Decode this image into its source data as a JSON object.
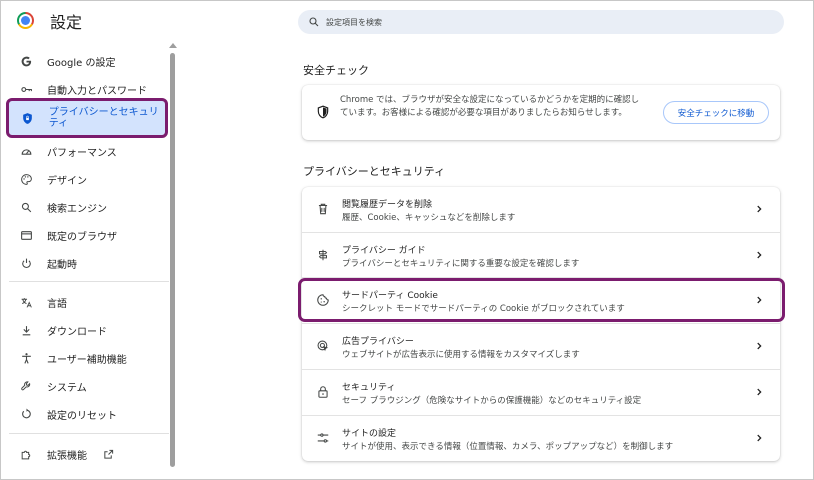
{
  "app": {
    "title": "設定"
  },
  "search": {
    "placeholder": "設定項目を検索"
  },
  "sidebar": {
    "items": [
      {
        "label": "Google の設定",
        "icon": "google-icon"
      },
      {
        "label": "自動入力とパスワード",
        "icon": "key-icon"
      },
      {
        "label": "プライバシーとセキュリティ",
        "icon": "shield-icon",
        "active": true
      },
      {
        "label": "パフォーマンス",
        "icon": "speedometer-icon"
      },
      {
        "label": "デザイン",
        "icon": "palette-icon"
      },
      {
        "label": "検索エンジン",
        "icon": "search-icon"
      },
      {
        "label": "既定のブラウザ",
        "icon": "browser-icon"
      },
      {
        "label": "起動時",
        "icon": "power-icon"
      },
      {
        "label": "言語",
        "icon": "translate-icon"
      },
      {
        "label": "ダウンロード",
        "icon": "download-icon"
      },
      {
        "label": "ユーザー補助機能",
        "icon": "accessibility-icon"
      },
      {
        "label": "システム",
        "icon": "wrench-icon"
      },
      {
        "label": "設定のリセット",
        "icon": "reset-icon"
      },
      {
        "label": "拡張機能",
        "icon": "puzzle-icon"
      }
    ]
  },
  "safety": {
    "section_title": "安全チェック",
    "description": "Chrome では、ブラウザが安全な設定になっているかどうかを定期的に確認しています。お客様による確認が必要な項目がありましたらお知らせします。",
    "button": "安全チェックに移動"
  },
  "privacy": {
    "section_title": "プライバシーとセキュリティ",
    "rows": [
      {
        "title": "閲覧履歴データを削除",
        "sub": "履歴、Cookie、キャッシュなどを削除します",
        "icon": "trash-icon"
      },
      {
        "title": "プライバシー ガイド",
        "sub": "プライバシーとセキュリティに関する重要な設定を確認します",
        "icon": "guide-icon"
      },
      {
        "title": "サードパーティ Cookie",
        "sub": "シークレット モードでサードパーティの Cookie がブロックされています",
        "icon": "cookie-icon"
      },
      {
        "title": "広告プライバシー",
        "sub": "ウェブサイトが広告表示に使用する情報をカスタマイズします",
        "icon": "ad-privacy-icon"
      },
      {
        "title": "セキュリティ",
        "sub": "セーフ ブラウジング（危険なサイトからの保護機能）などのセキュリティ設定",
        "icon": "lock-icon"
      },
      {
        "title": "サイトの設定",
        "sub": "サイトが使用、表示できる情報（位置情報、カメラ、ポップアップなど）を制御します",
        "icon": "sliders-icon"
      }
    ]
  },
  "colors": {
    "accent": "#0b57d0",
    "active_bg": "#d3e3fd",
    "highlight_border": "#7b1c6e",
    "search_bg": "#e9eef6"
  }
}
